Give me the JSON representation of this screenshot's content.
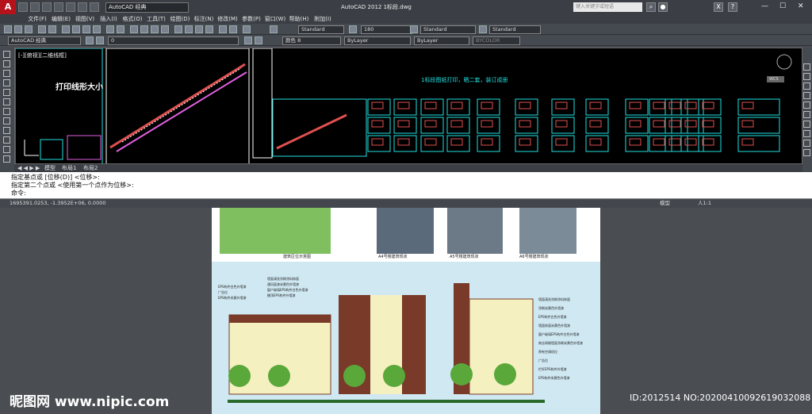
{
  "app": {
    "logo": "A",
    "workspace": "AutoCAD 经典",
    "title": "AutoCAD 2012    1标段.dwg",
    "search_placeholder": "键入关键字或短语",
    "window_buttons": [
      "—",
      "☐",
      "✕"
    ]
  },
  "menu": [
    "文件(F)",
    "编辑(E)",
    "视图(V)",
    "插入(I)",
    "格式(O)",
    "工具(T)",
    "绘图(D)",
    "标注(N)",
    "修改(M)",
    "参数(P)",
    "窗口(W)",
    "帮助(H)",
    "附加(I)"
  ],
  "toolbar": {
    "text_style": "Standard",
    "text_height": "180",
    "dim_style": "Standard",
    "table_style": "Standard",
    "workspace2": "AutoCAD 经典",
    "layer": "0",
    "color": "颜色 8",
    "linetype": "ByLayer",
    "lineweight": "ByLayer",
    "plotstyle": "BYCOLOR"
  },
  "drawing": {
    "viewport_label": "[-][俯视][二维线框]",
    "layout_title": "打印线形大小",
    "note": "1标段图纸打印，晒二套，装订成册",
    "wcs": "WCS"
  },
  "tabs": [
    "模型",
    "布局1",
    "布局2"
  ],
  "command": {
    "lines": [
      "指定基点或 [位移(D)] <位移>:",
      "指定第二个点或 <使用第一个点作为位移>:",
      "命令:"
    ]
  },
  "status": {
    "coords": "1695391.0253, -1.3952E+06, 0.0000",
    "model": "模型",
    "scale": "人1:1"
  },
  "preview": {
    "captions": [
      "建筑区位示意图",
      "A4号楼建筑现状",
      "A5号楼建筑现状",
      "A6号楼建筑现状"
    ],
    "left_notes": [
      "EPS构件白色外墙漆",
      "广告位",
      "EPS构件米黄外墙漆"
    ],
    "center_notes": [
      "墙面清洗涂刷涂料饰面",
      "通风面漆米黄色外墙漆",
      "窗户玻璃EPS构件白色外墙漆",
      "棚顶EPS构件外墙漆"
    ],
    "right_notes": [
      "墙面清洗涂刷涂料饰面",
      "涂刷米黄色外墙漆",
      "EPS构件白色外墙漆",
      "墙面饰面米黄色外墙漆",
      "窗户玻璃EPS构件白色外墙漆",
      "商业网格墙面涂刷米黄色外墙漆",
      "原有空调机位",
      "广告位",
      "栏杆EPS构件外墙漆",
      "EPS构件米黄色外墙漆"
    ]
  },
  "watermark": {
    "left": "昵图网 www.nipic.com",
    "right": "ID:2012514 NO:20200410092619032088"
  }
}
